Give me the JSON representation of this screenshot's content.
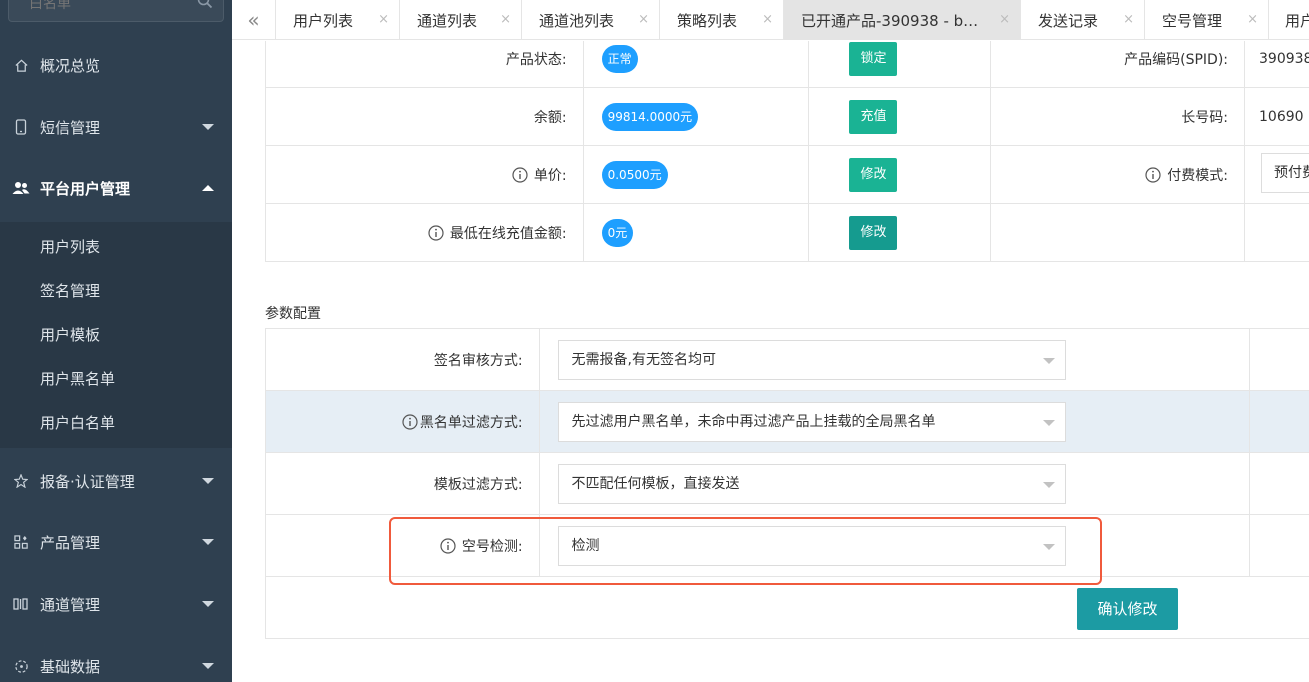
{
  "sidebar": {
    "search_placeholder": "白名单",
    "nav": [
      {
        "label": "概况总览"
      },
      {
        "label": "短信管理"
      },
      {
        "label": "平台用户管理"
      },
      {
        "label": "报备·认证管理"
      },
      {
        "label": "产品管理"
      },
      {
        "label": "通道管理"
      },
      {
        "label": "基础数据"
      }
    ],
    "submenu": [
      "用户列表",
      "签名管理",
      "用户模板",
      "用户黑名单",
      "用户白名单"
    ]
  },
  "tabs": [
    {
      "label": "用户列表",
      "close": "×"
    },
    {
      "label": "通道列表",
      "close": "×"
    },
    {
      "label": "通道池列表",
      "close": "×"
    },
    {
      "label": "策略列表",
      "close": "×"
    },
    {
      "label": "已开通产品-390938 - b…",
      "close": "×"
    },
    {
      "label": "发送记录",
      "close": "×"
    },
    {
      "label": "空号管理",
      "close": "×"
    },
    {
      "label": "用户",
      "close": ""
    }
  ],
  "product": {
    "rows": [
      {
        "label": "产品状态:",
        "value": "正常",
        "action": "锁定",
        "right_label": "产品编码(SPID):",
        "right_value": "390938"
      },
      {
        "label": "余额:",
        "value": "99814.0000元",
        "action": "充值",
        "right_label": "长号码:",
        "right_value": "10690"
      },
      {
        "label": "单价:",
        "value": "0.0500元",
        "action": "修改",
        "right_label": "付费模式:",
        "right_value": "预付费"
      },
      {
        "label": "最低在线充值金额:",
        "value": "0元",
        "action": "修改",
        "right_label": "",
        "right_value": ""
      }
    ]
  },
  "params": {
    "title": "参数配置",
    "rows": [
      {
        "label": "签名审核方式:",
        "value": "无需报备,有无签名均可"
      },
      {
        "label": "黑名单过滤方式:",
        "value": "先过滤用户黑名单，未命中再过滤产品上挂载的全局黑名单"
      },
      {
        "label": "模板过滤方式:",
        "value": "不匹配任何模板，直接发送"
      },
      {
        "label": "空号检测:",
        "value": "检测"
      }
    ],
    "confirm_label": "确认修改"
  }
}
